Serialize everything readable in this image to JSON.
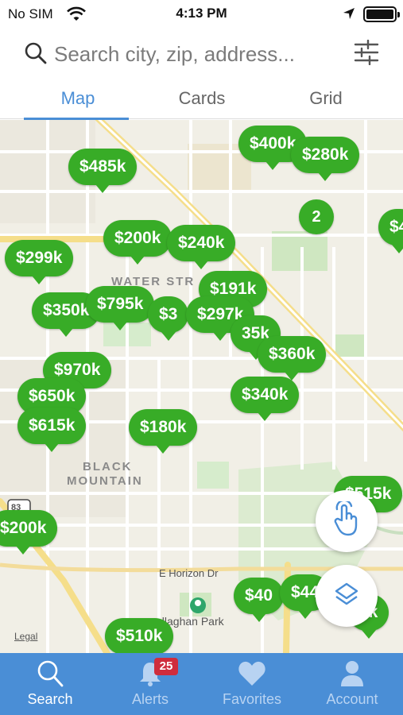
{
  "status": {
    "carrier": "No SIM",
    "time": "4:13 PM"
  },
  "search": {
    "placeholder": "Search city, zip, address..."
  },
  "tabs": [
    {
      "label": "Map",
      "active": true
    },
    {
      "label": "Cards",
      "active": false
    },
    {
      "label": "Grid",
      "active": false
    }
  ],
  "map": {
    "area_label_1": "BLACK",
    "area_label_2": "MOUNTAIN",
    "water_street": "WATER STR",
    "street": "E Horizon Dr",
    "park": "allaghan Park",
    "legal": "Legal",
    "route_shield": "83",
    "pins": [
      {
        "label": "$400k"
      },
      {
        "label": "$280k"
      },
      {
        "label": "$485k"
      },
      {
        "label": "2"
      },
      {
        "label": "$4"
      },
      {
        "label": "$200k"
      },
      {
        "label": "$240k"
      },
      {
        "label": "$299k"
      },
      {
        "label": "$191k"
      },
      {
        "label": "$350k"
      },
      {
        "label": "$795k"
      },
      {
        "label": "$3"
      },
      {
        "label": "$297k"
      },
      {
        "label": "35k"
      },
      {
        "label": "$360k"
      },
      {
        "label": "$970k"
      },
      {
        "label": "$650k"
      },
      {
        "label": "$340k"
      },
      {
        "label": "$615k"
      },
      {
        "label": "$180k"
      },
      {
        "label": "$515k"
      },
      {
        "label": "$200k"
      },
      {
        "label": "$40"
      },
      {
        "label": "$44"
      },
      {
        "label": "0k"
      },
      {
        "label": "$510k"
      }
    ]
  },
  "tabbar": {
    "items": [
      {
        "label": "Search",
        "icon": "search-icon",
        "active": true
      },
      {
        "label": "Alerts",
        "icon": "bell-icon",
        "active": false,
        "badge": "25"
      },
      {
        "label": "Favorites",
        "icon": "heart-icon",
        "active": false
      },
      {
        "label": "Account",
        "icon": "person-icon",
        "active": false
      }
    ]
  },
  "colors": {
    "accent": "#4a8ed6",
    "pin": "#38ac27",
    "badge": "#cf2d3d",
    "map_bg": "#f1efe6"
  }
}
